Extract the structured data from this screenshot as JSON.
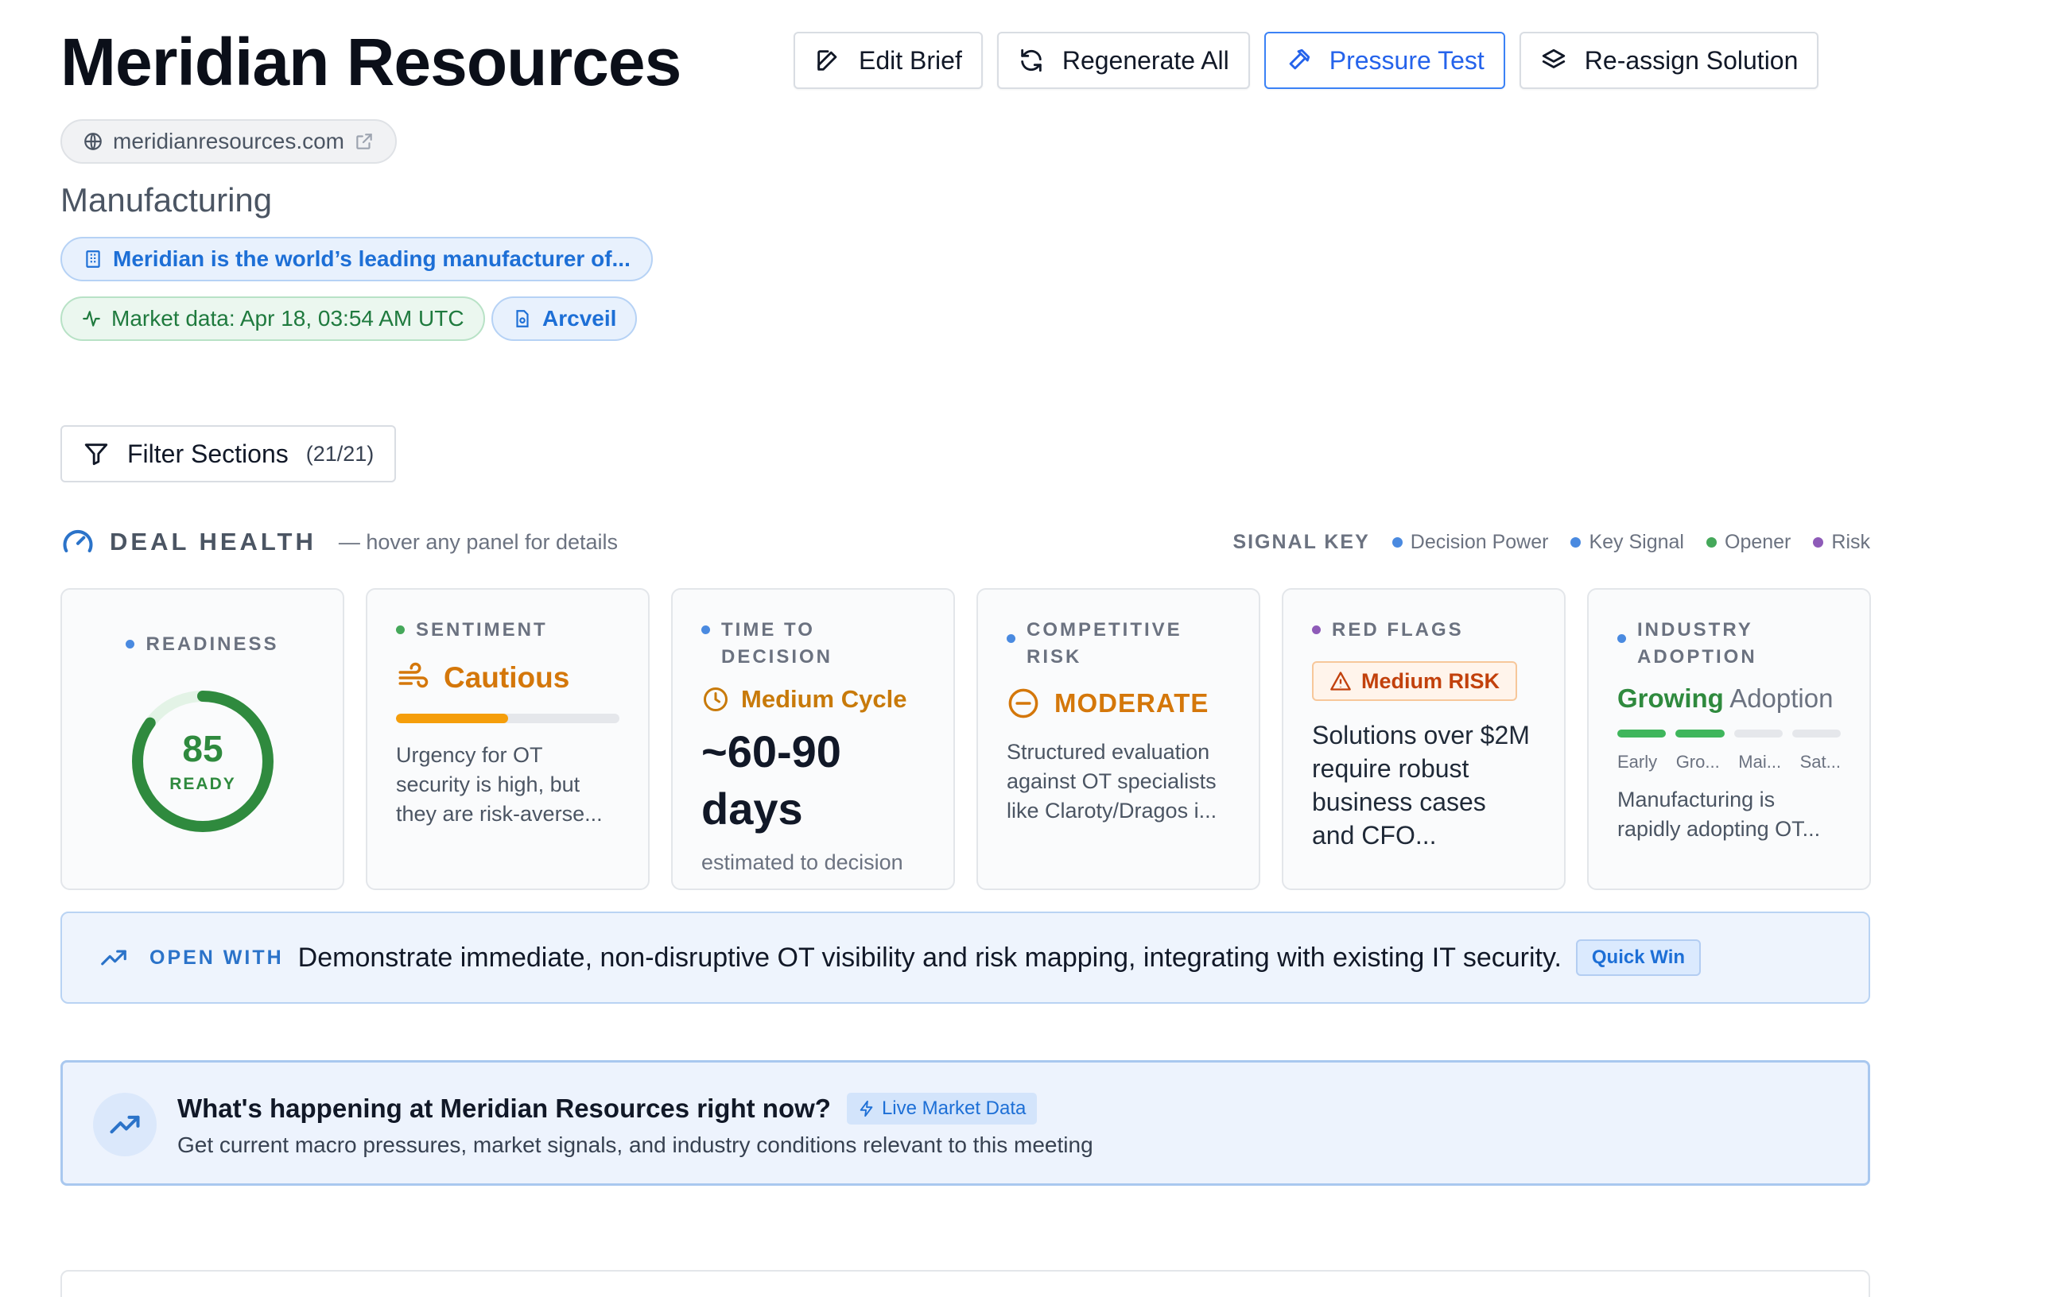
{
  "header": {
    "title": "Meridian Resources",
    "domain": "meridianresources.com",
    "industry": "Manufacturing",
    "description": "Meridian is the world’s leading manufacturer of...",
    "market_data": "Market data: Apr 18, 03:54 AM UTC",
    "source": "Arcveil"
  },
  "toolbar": {
    "edit": "Edit Brief",
    "regenerate": "Regenerate All",
    "pressure": "Pressure Test",
    "reassign": "Re-assign Solution"
  },
  "filter": {
    "label": "Filter Sections",
    "count": "(21/21)"
  },
  "deal_health": {
    "title": "DEAL HEALTH",
    "subtitle": "— hover any panel for details",
    "signal_key_label": "SIGNAL KEY",
    "signal_key": [
      {
        "label": "Decision Power",
        "color": "#4a8ae0"
      },
      {
        "label": "Key Signal",
        "color": "#4a8ae0"
      },
      {
        "label": "Opener",
        "color": "#45a85a"
      },
      {
        "label": "Risk",
        "color": "#8e5bb8"
      }
    ]
  },
  "cards": {
    "readiness": {
      "label": "READINESS",
      "value": "85",
      "value_pct": 85,
      "sub": "READY",
      "dot": "#4a8ae0"
    },
    "sentiment": {
      "label": "SENTIMENT",
      "value": "Cautious",
      "level": 0.5,
      "text": "Urgency for OT security is high, but they are risk-averse...",
      "dot": "#45a85a"
    },
    "ttd": {
      "label": "TIME TO DECISION",
      "value": "Medium Cycle",
      "big1": "~60-90",
      "big2": "days",
      "sub": "estimated to decision",
      "dot": "#4a8ae0"
    },
    "competitive": {
      "label1": "COMPETITIVE",
      "label2": "RISK",
      "value": "MODERATE",
      "text": "Structured evaluation against OT specialists like Claroty/Dragos i...",
      "dot": "#4a8ae0"
    },
    "red_flags": {
      "label": "RED FLAGS",
      "badge": "Medium RISK",
      "text": "Solutions over $2M require robust business cases and CFO...",
      "dot": "#8e5bb8"
    },
    "adoption": {
      "label1": "INDUSTRY",
      "label2": "ADOPTION",
      "value_strong": "Growing",
      "value_rest": "Adoption",
      "stages": [
        "Early",
        "Gro...",
        "Mai...",
        "Sat..."
      ],
      "active_stages": 2,
      "text": "Manufacturing is rapidly adopting OT...",
      "dot": "#4a8ae0"
    }
  },
  "open_with": {
    "label": "OPEN WITH",
    "text": "Demonstrate immediate, non-disruptive OT visibility and risk mapping, integrating with existing IT security.",
    "badge": "Quick Win"
  },
  "live": {
    "title": "What's happening at Meridian Resources right now?",
    "badge": "Live Market Data",
    "subtitle": "Get current macro pressures, market signals, and industry conditions relevant to this meeting"
  }
}
